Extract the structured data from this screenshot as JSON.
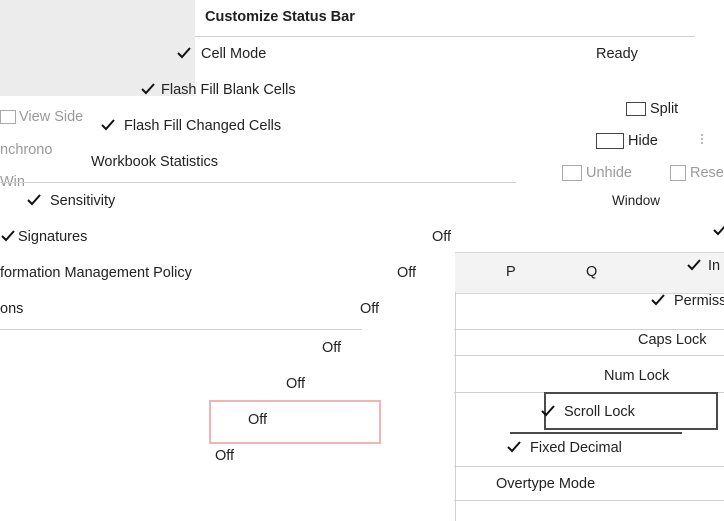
{
  "menu": {
    "title": "Customize Status Bar",
    "items": [
      {
        "label": "Cell Mode",
        "value": "Ready",
        "checked": true
      },
      {
        "label": "Flash Fill Blank Cells",
        "value": "",
        "checked": true
      },
      {
        "label": "Flash Fill Changed Cells",
        "value": "",
        "checked": true
      },
      {
        "label": "Workbook Statistics",
        "value": "",
        "checked": false
      },
      {
        "label": "Sensitivity",
        "value": "",
        "checked": true
      },
      {
        "label": "Signatures",
        "value": "Off",
        "checked": true
      },
      {
        "label": "formation Management Policy",
        "value": "Off",
        "checked": true
      },
      {
        "label": "ons",
        "value": "Off",
        "checked": false
      }
    ],
    "offs": [
      "Off",
      "Off",
      "Off",
      "Off"
    ],
    "right_items": [
      {
        "label": "Permiss",
        "checked": true
      },
      {
        "label": "Caps Lock",
        "checked": false
      },
      {
        "label": "Num Lock",
        "checked": false
      },
      {
        "label": "Scroll Lock",
        "checked": true
      },
      {
        "label": "Fixed Decimal",
        "checked": true
      },
      {
        "label": "Overtype Mode",
        "checked": false
      }
    ],
    "partial_right": "In"
  },
  "ribbon": {
    "view_side": "View Side",
    "nchrono": "nchrono",
    "win": "Win",
    "split": "Split",
    "hide": "Hide",
    "unhide": "Unhide",
    "reset": "Rese",
    "window_group": "Window",
    "col_p": "P",
    "col_q": "Q"
  }
}
